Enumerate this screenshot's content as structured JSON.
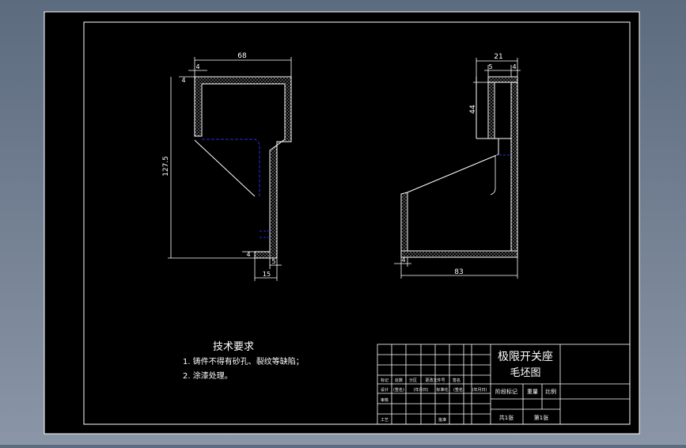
{
  "colors": {
    "background": "#6f7c8f",
    "paper": "#000000",
    "lines": "#ffffff",
    "hidden_lines": "#2233cc",
    "hatch": "#bbbbbb"
  },
  "front_view": {
    "dim_width": "68",
    "dim_wall_left": "4",
    "dim_wall_top": "4",
    "dim_height": "127.5",
    "dim_bottom_wall": "4",
    "dim_step": "5",
    "dim_foot": "15"
  },
  "side_view": {
    "dim_width": "21",
    "dim_gap": "5",
    "dim_wall": "4",
    "dim_depth": "44",
    "dim_bottom_left": "4",
    "dim_length": "83"
  },
  "tech_requirements": {
    "title": "技术要求",
    "items": [
      "1. 铸件不得有砂孔、裂纹等缺陷；",
      "2. 涂漆处理。"
    ]
  },
  "title_block": {
    "part_name_line1": "极限开关座",
    "part_name_line2": "毛坯图",
    "row_labels": [
      "标记",
      "处数",
      "分区",
      "更改文件号",
      "签名"
    ],
    "row2_labels": [
      "设计",
      "(签名)",
      "(年月日)",
      "标准化",
      "(签名)",
      "(年月日)"
    ],
    "left_labels": [
      "审核",
      "工艺"
    ],
    "approve_label": "批准",
    "stage_label": "阶段标记",
    "weight_label": "重量",
    "scale_label": "比例",
    "sheets_total": "共1张",
    "sheet_no": "第1张"
  }
}
